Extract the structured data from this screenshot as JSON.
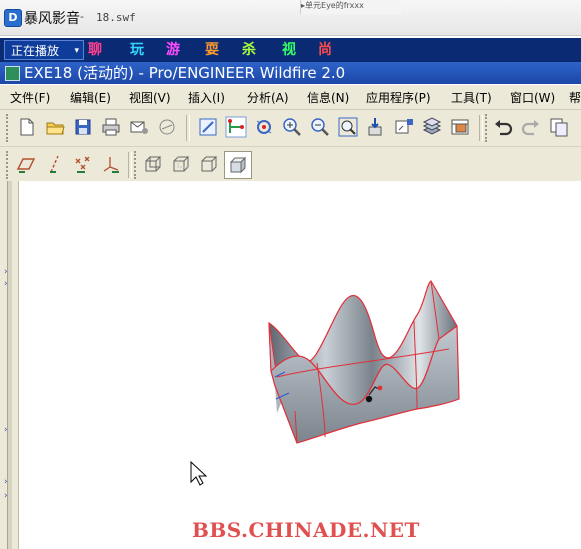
{
  "player": {
    "app_title": "暴风影音",
    "separator": " -",
    "file_name": "18.swf",
    "bg_window_text": "▸单元Eye的frxxx",
    "now_playing": "正在播放",
    "dropdown_arrow": "▾",
    "promo": [
      {
        "char": "聊",
        "color": "#ff3e8d"
      },
      {
        "char": "玩",
        "color": "#33d8ff"
      },
      {
        "char": "游",
        "color": "#ff4cff"
      },
      {
        "char": "耍",
        "color": "#ff9a2b"
      },
      {
        "char": "杀",
        "color": "#a8ff3a"
      },
      {
        "char": "视",
        "color": "#33ff66"
      },
      {
        "char": "尚",
        "color": "#ff4a4a"
      }
    ]
  },
  "window": {
    "title": "EXE18 (活动的) - Pro/ENGINEER Wildfire 2.0"
  },
  "menu": {
    "items": [
      "文件(F)",
      "编辑(E)",
      "视图(V)",
      "插入(I)",
      "分析(A)",
      "信息(N)",
      "应用程序(P)",
      "工具(T)",
      "窗口(W)",
      "帮"
    ]
  },
  "toolbar1": {
    "icons": [
      "new-icon",
      "open-icon",
      "save-icon",
      "print-icon",
      "email-icon",
      "link-icon",
      "regenerate-icon",
      "datum-axis-icon",
      "spin-center-icon",
      "zoom-in-icon",
      "zoom-out-icon",
      "refit-icon",
      "reorient-icon",
      "view-manager-icon",
      "layers-icon",
      "saved-views-icon",
      "undo-icon",
      "redo-icon",
      "copy-icon"
    ]
  },
  "toolbar2": {
    "icons": [
      "datum-plane-icon",
      "datum-axis-display-icon",
      "datum-point-icon",
      "coordinate-system-icon",
      "wireframe-icon",
      "hidden-line-icon",
      "no-hidden-icon",
      "shading-icon"
    ]
  },
  "watermark": "BBS.CHINADE.NET",
  "colors": {
    "player_bar": "#0b2a74",
    "proe_title": "#1c47a7",
    "toolbar_bg": "#ece9d8",
    "model_edge": "#e0303a",
    "watermark": "#e05050"
  }
}
